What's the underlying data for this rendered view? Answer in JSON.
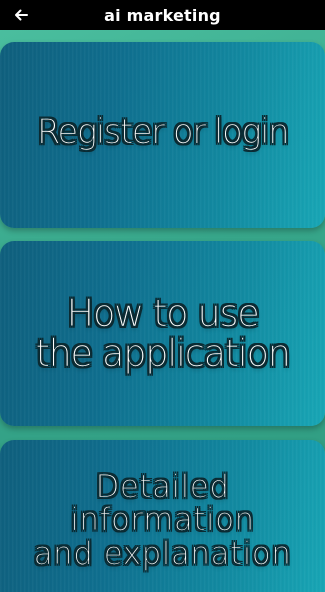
{
  "header": {
    "title": "ai marketing",
    "back_icon": "arrow-left-icon"
  },
  "menu": {
    "items": [
      {
        "label": "Register or login"
      },
      {
        "label": "How to use\nthe application"
      },
      {
        "label": "Detailed information\nand explanation"
      }
    ]
  },
  "colors": {
    "topbar": "#000000",
    "background": "#3fae93",
    "card_dark": "#0f5f7d",
    "card_light": "#18a7b6",
    "text": "#ffffff"
  }
}
